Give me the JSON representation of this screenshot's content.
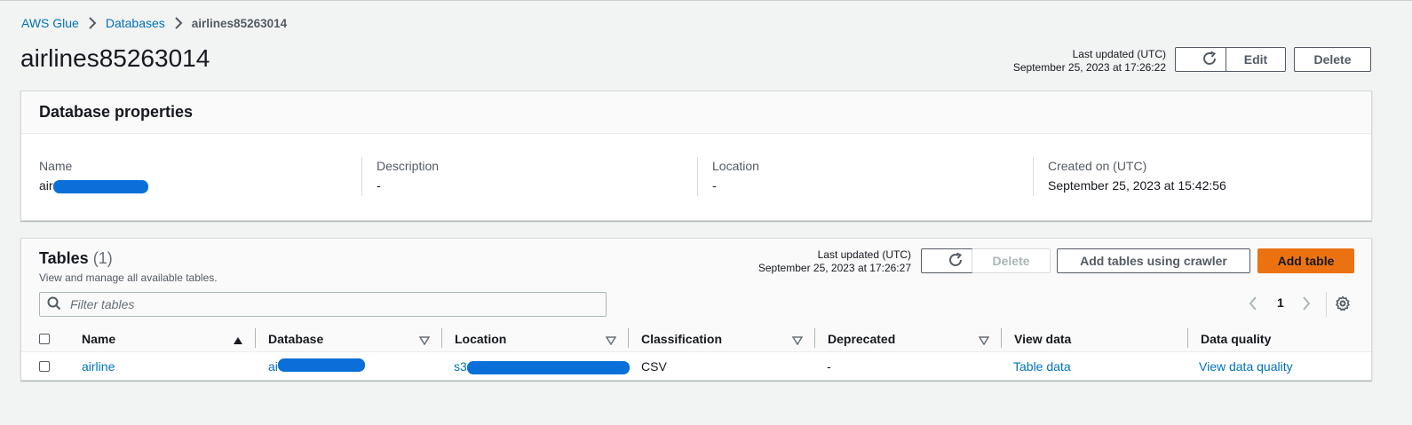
{
  "breadcrumb": {
    "items": [
      "AWS Glue",
      "Databases"
    ],
    "current": "airlines85263014"
  },
  "page": {
    "title": "airlines85263014",
    "last_updated_label": "Last updated (UTC)",
    "last_updated_value": "September 25, 2023 at 17:26:22",
    "edit_label": "Edit",
    "delete_label": "Delete"
  },
  "properties": {
    "title": "Database properties",
    "name_label": "Name",
    "name_value": "air",
    "description_label": "Description",
    "description_value": "-",
    "location_label": "Location",
    "location_value": "-",
    "created_label": "Created on (UTC)",
    "created_value": "September 25, 2023 at 15:42:56"
  },
  "tables": {
    "title": "Tables",
    "count": "(1)",
    "subtitle": "View and manage all available tables.",
    "last_updated_label": "Last updated (UTC)",
    "last_updated_value": "September 25, 2023 at 17:26:27",
    "delete_label": "Delete",
    "crawler_label": "Add tables using crawler",
    "add_label": "Add table",
    "filter_placeholder": "Filter tables",
    "page_number": "1",
    "columns": [
      "Name",
      "Database",
      "Location",
      "Classification",
      "Deprecated",
      "View data",
      "Data quality"
    ],
    "rows": [
      {
        "name": "airline",
        "database": "ai",
        "location": "s3",
        "classification": "CSV",
        "deprecated": "-",
        "view_data": "Table data",
        "data_quality": "View data quality"
      }
    ]
  },
  "colors": {
    "link": "#0073bb",
    "primary_button": "#ec7211",
    "redaction": "#0a6fd8"
  }
}
